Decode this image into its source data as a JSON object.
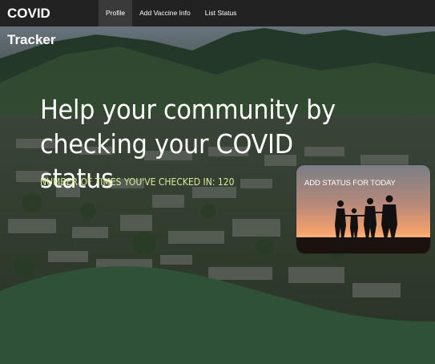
{
  "navbar": {
    "brand": "COVID Tracker",
    "items": [
      {
        "label": "Profile",
        "active": true
      },
      {
        "label": "Add Vaccine Info",
        "active": false
      },
      {
        "label": "List Status",
        "active": false
      }
    ]
  },
  "hero": {
    "headline_line1": "Help your community by",
    "headline_line2": "checking your COVID status",
    "counter_text": "NUMBER OF TIMES YOU'VE CHECKED IN: 120"
  },
  "status_card": {
    "label": "ADD STATUS FOR TODAY"
  },
  "colors": {
    "navbar_bg": "#222222",
    "active_tab_bg": "#3a3a3a",
    "counter_text": "#d8eb9c",
    "bottom_wave": "#2f5137"
  }
}
